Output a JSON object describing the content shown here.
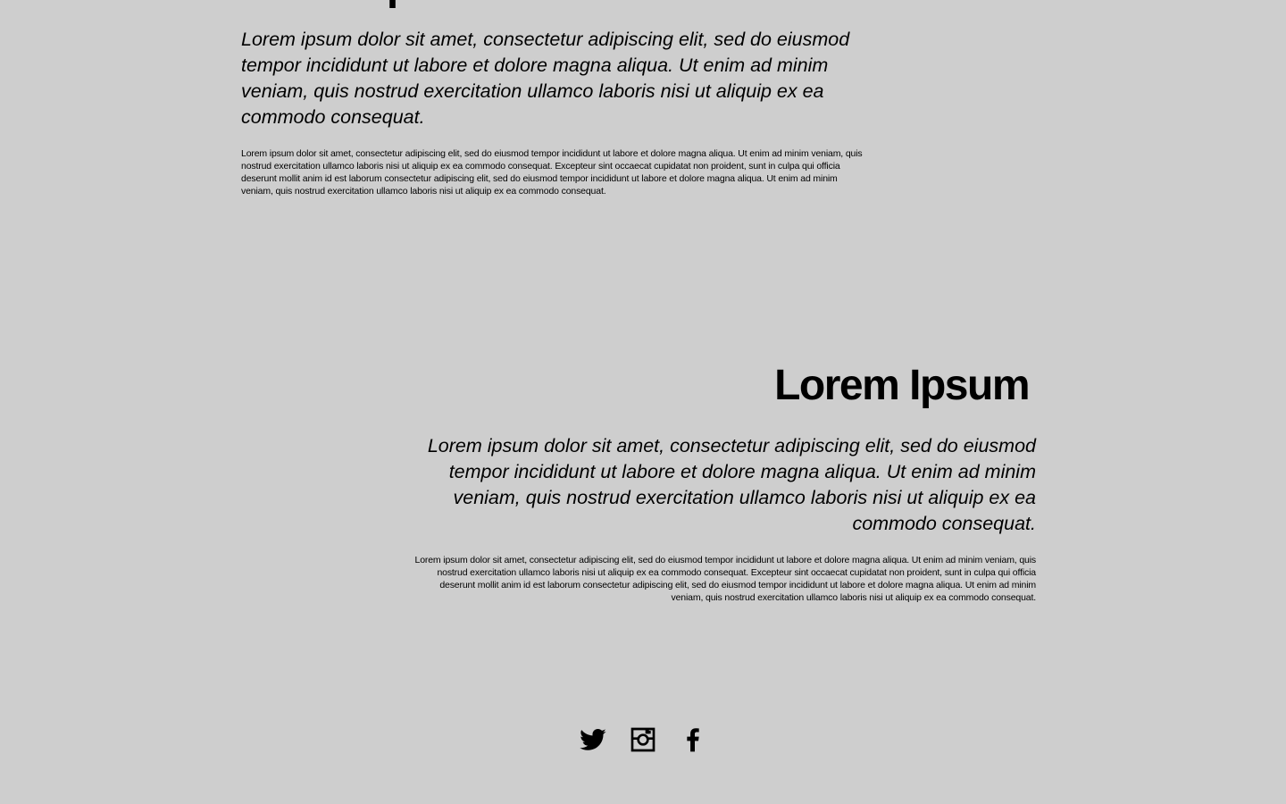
{
  "section_one": {
    "heading": "Lorem Ipsum",
    "lead": "Lorem ipsum dolor sit amet, consectetur adipiscing elit, sed do eiusmod tempor incididunt ut labore et dolore magna aliqua. Ut enim ad minim veniam, quis nostrud exercitation ullamco laboris nisi ut aliquip ex ea commodo consequat.",
    "body": "Lorem ipsum dolor sit amet, consectetur adipiscing elit, sed do eiusmod tempor incididunt ut labore et dolore magna aliqua. Ut enim ad minim veniam, quis nostrud exercitation ullamco laboris nisi ut aliquip ex ea commodo consequat. Excepteur sint occaecat cupidatat non proident, sunt in culpa qui officia deserunt mollit anim id est laborum consectetur adipiscing elit, sed do eiusmod tempor incididunt ut labore et dolore magna aliqua. Ut enim ad minim veniam, quis nostrud exercitation ullamco laboris nisi ut aliquip ex ea commodo consequat."
  },
  "section_two": {
    "heading": "Lorem Ipsum",
    "lead": "Lorem ipsum dolor sit amet, consectetur adipiscing elit, sed do eiusmod tempor incididunt ut labore et dolore magna aliqua. Ut enim ad minim veniam, quis nostrud exercitation ullamco laboris nisi ut aliquip ex ea commodo consequat.",
    "body": "Lorem ipsum dolor sit amet, consectetur adipiscing elit, sed do eiusmod tempor incididunt ut labore et dolore magna aliqua. Ut enim ad minim veniam, quis nostrud exercitation ullamco laboris nisi ut aliquip ex ea commodo consequat. Excepteur sint occaecat cupidatat non proident, sunt in culpa qui officia deserunt mollit anim id est laborum consectetur adipiscing elit, sed do eiusmod tempor incididunt ut labore et dolore magna aliqua. Ut enim ad minim veniam, quis nostrud exercitation ullamco laboris nisi ut aliquip ex ea commodo consequat."
  },
  "social": {
    "icons": [
      "twitter-icon",
      "instagram-icon",
      "facebook-icon"
    ]
  },
  "colors": {
    "background": "#cecece",
    "text": "#000000"
  }
}
